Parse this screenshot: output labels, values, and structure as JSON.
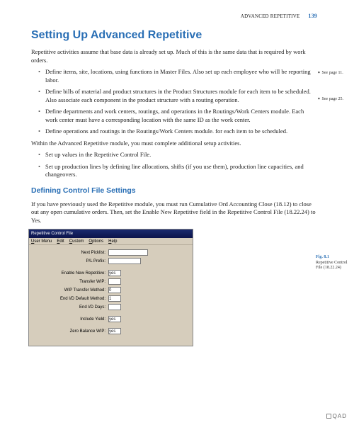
{
  "header": {
    "running": "ADVANCED REPETITIVE",
    "page": "139"
  },
  "title": "Setting Up Advanced Repetitive",
  "intro": "Repetitive activities assume that base data is already set up. Much of this is the same data that is required by work orders.",
  "bullets1": [
    "Define items, site, locations, using functions in Master Files. Also set up each employee who will be reporting labor.",
    "Define bills of material and product structures in the Product Structures module for each item to be scheduled. Also associate each component in the product structure with a routing operation.",
    "Define departments and work centers, routings, and operations in the Routings/Work Centers module. Each work center must have a corresponding location with the same ID as the work center.",
    "Define operations and routings in the Routings/Work Centers module. for each item to be scheduled."
  ],
  "mid": "Within the Advanced Repetitive module, you must complete additional setup activities.",
  "bullets2": [
    "Set up values in the Repetitive Control File.",
    "Set up production lines by defining line allocations, shifts (if you use them), production line capacities, and changeovers."
  ],
  "subtitle": "Defining Control File Settings",
  "para2": "If you have previously used the Repetitive module, you must run Cumulative Ord Accounting Close (18.12) to close out any open cumulative orders. Then, set the Enable New Repetitive field in the Repetitive Control File (18.22.24) to Yes.",
  "sidenotes": {
    "sn1": "➧ See page 11.",
    "sn2": "➧ See page 25."
  },
  "figure": {
    "num": "Fig. 8.1",
    "cap": "Repetitive Control File (18.22.24)"
  },
  "window": {
    "title": "Repetitive Control File",
    "menus": [
      "User Menu",
      "Edit",
      "Custom",
      "Options",
      "Help"
    ],
    "fields": [
      {
        "label": "Next Picklist:",
        "size": "long"
      },
      {
        "label": "P/L Prefix:",
        "size": "med"
      },
      {
        "label": "Enable New Repetitive:",
        "size": "short",
        "value": "yes"
      },
      {
        "label": "Transfer WIP:",
        "size": "short"
      },
      {
        "label": "WIP Transfer Method:",
        "size": "short",
        "value": "0"
      },
      {
        "label": "End I/D Default Method:",
        "size": "short",
        "value": "1"
      },
      {
        "label": "End I/D Days:",
        "size": "short"
      },
      {
        "label": "Include Yield:",
        "size": "short",
        "value": "yes"
      },
      {
        "label": "Zero Balance WIP:",
        "size": "short",
        "value": "yes"
      }
    ]
  },
  "brand": "QAD"
}
